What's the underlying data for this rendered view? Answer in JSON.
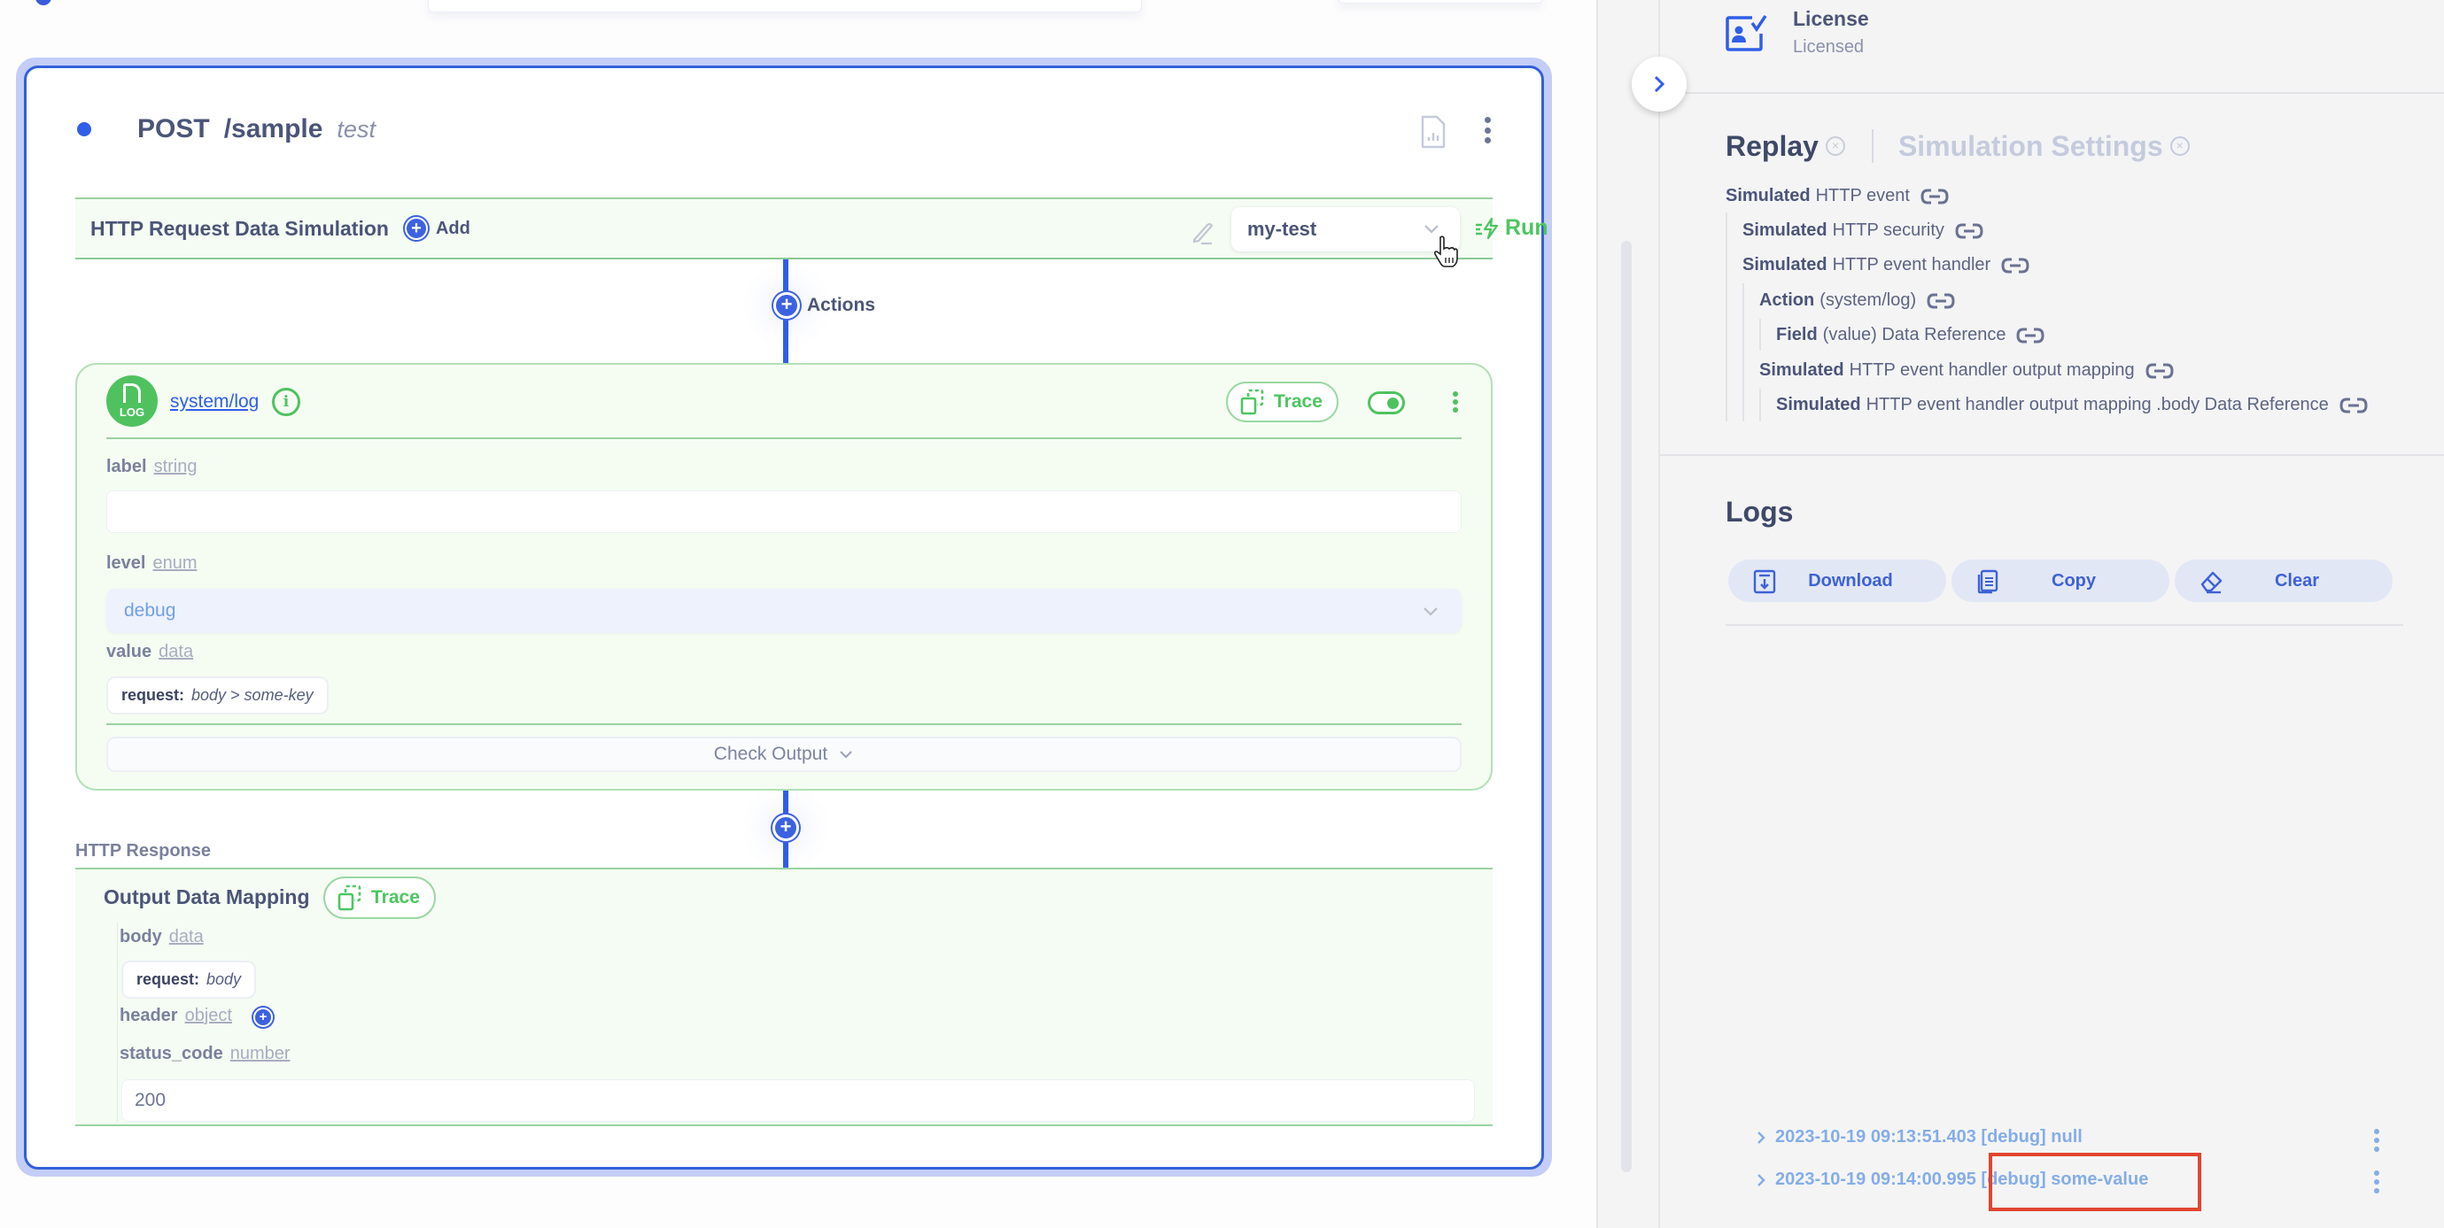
{
  "endpoint": {
    "method": "POST",
    "path": "/sample",
    "name": "test"
  },
  "simulation": {
    "title": "HTTP Request Data Simulation",
    "add_label": "Add",
    "selected_test": "my-test",
    "run_label": "Run"
  },
  "actions": {
    "label": "Actions",
    "items": [
      {
        "link": "system/log",
        "badge": "LOG",
        "trace_label": "Trace",
        "enabled": true,
        "fields": {
          "label": {
            "name": "label",
            "type": "string",
            "value": ""
          },
          "level": {
            "name": "level",
            "type": "enum",
            "value": "debug"
          },
          "value": {
            "name": "value",
            "type": "data",
            "source": "request:",
            "path": "body > some-key"
          }
        },
        "check_output_label": "Check Output"
      }
    ]
  },
  "response": {
    "section_label": "HTTP Response",
    "mapping_title": "Output Data Mapping",
    "trace_label": "Trace",
    "fields": {
      "body": {
        "name": "body",
        "type": "data",
        "source": "request:",
        "path": "body"
      },
      "header": {
        "name": "header",
        "type": "object"
      },
      "status_code": {
        "name": "status_code",
        "type": "number",
        "value": "200"
      }
    }
  },
  "panel": {
    "license": {
      "title": "License",
      "status": "Licensed"
    },
    "tabs": [
      {
        "label": "Replay",
        "active": true
      },
      {
        "label": "Simulation Settings",
        "active": false
      }
    ],
    "replay_tree": [
      {
        "bold": "Simulated",
        "rest": "HTTP event",
        "depth": 0
      },
      {
        "bold": "Simulated",
        "rest": "HTTP security",
        "depth": 1
      },
      {
        "bold": "Simulated",
        "rest": "HTTP event handler",
        "depth": 1
      },
      {
        "bold": "Action",
        "rest": "(system/log)",
        "depth": 2
      },
      {
        "bold": "Field",
        "rest": "(value) Data Reference",
        "depth": 3
      },
      {
        "bold": "Simulated",
        "rest": "HTTP event handler output mapping",
        "depth": 2
      },
      {
        "bold": "Simulated",
        "rest": "HTTP event handler output mapping .body Data Reference",
        "depth": 3
      }
    ],
    "logs": {
      "title": "Logs",
      "buttons": {
        "download": "Download",
        "copy": "Copy",
        "clear": "Clear"
      },
      "entries": [
        {
          "text": "2023-10-19 09:13:51.403 [debug] null"
        },
        {
          "text": "2023-10-19 09:14:00.995 [debug] some-value"
        }
      ]
    }
  },
  "colors": {
    "accent_blue": "#2f5ee8",
    "success_green": "#4cc660",
    "highlight_red": "#e2452f"
  }
}
